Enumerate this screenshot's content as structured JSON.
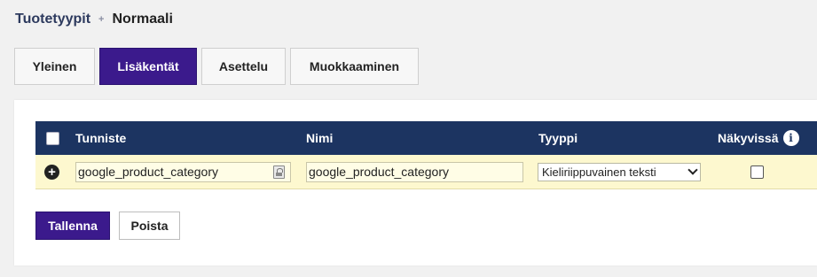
{
  "breadcrumb": {
    "parent": "Tuotetyypit",
    "separator": "+",
    "current": "Normaali"
  },
  "tabs": [
    {
      "label": "Yleinen",
      "active": false
    },
    {
      "label": "Lisäkentät",
      "active": true
    },
    {
      "label": "Asettelu",
      "active": false
    },
    {
      "label": "Muokkaaminen",
      "active": false
    }
  ],
  "table": {
    "headers": {
      "tunniste": "Tunniste",
      "nimi": "Nimi",
      "tyyppi": "Tyyppi",
      "nakyvissa": "Näkyvissä",
      "info_glyph": "i"
    },
    "rows": [
      {
        "add_glyph": "+",
        "tunniste": "google_product_category",
        "nimi": "google_product_category",
        "tyyppi": "Kieliriippuvainen teksti",
        "nakyvissa": false
      }
    ]
  },
  "buttons": {
    "save": "Tallenna",
    "delete": "Poista"
  },
  "colors": {
    "accent": "#3b1a8c",
    "table_header": "#1c3461",
    "row_highlight": "#fdf8cf"
  },
  "icons": {
    "select_all": "checkbox-icon",
    "info": "info-icon",
    "add_row": "plus-circle-icon",
    "translate": "translate-icon",
    "dropdown": "chevron-down-icon"
  }
}
